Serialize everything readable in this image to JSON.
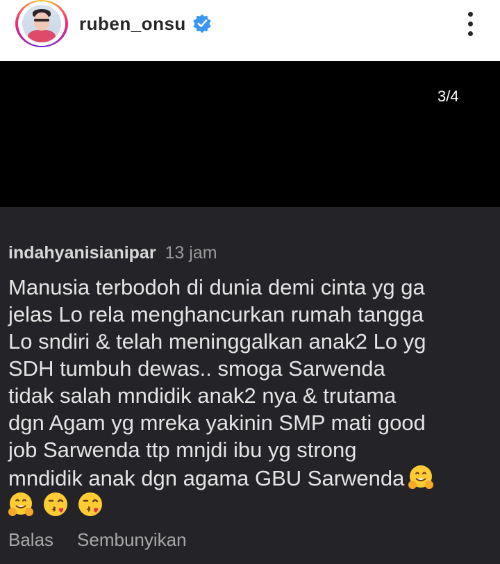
{
  "header": {
    "username": "ruben_onsu",
    "verified_icon": "verified-badge-icon",
    "more_icon": "more-vertical-icon",
    "verified_color": "#3897f0"
  },
  "media": {
    "page_indicator": "3/4"
  },
  "comment": {
    "username": "indahyanisianipar",
    "time": "13 jam",
    "lines": [
      "Manusia terbodoh di dunia demi cinta yg ga",
      "jelas Lo rela menghancurkan rumah tangga",
      "Lo sndiri & telah meninggalkan anak2 Lo yg",
      "SDH tumbuh dewas.. smoga Sarwenda",
      "tidak salah mndidik anak2 nya & trutama",
      "dgn Agam yg mreka yakinin SMP mati good",
      "job Sarwenda ttp mnjdi ibu yg strong",
      "mndidik anak dgn agama GBU Sarwenda"
    ],
    "emojis": [
      "hugging-face",
      "hugging-face",
      "face-blowing-kiss",
      "face-blowing-kiss"
    ],
    "actions": {
      "reply": "Balas",
      "hide": "Sembunyikan"
    }
  },
  "colors": {
    "comment_bg": "#242428",
    "comment_text": "#e4e4e4",
    "meta_text": "#9a9a9a"
  }
}
